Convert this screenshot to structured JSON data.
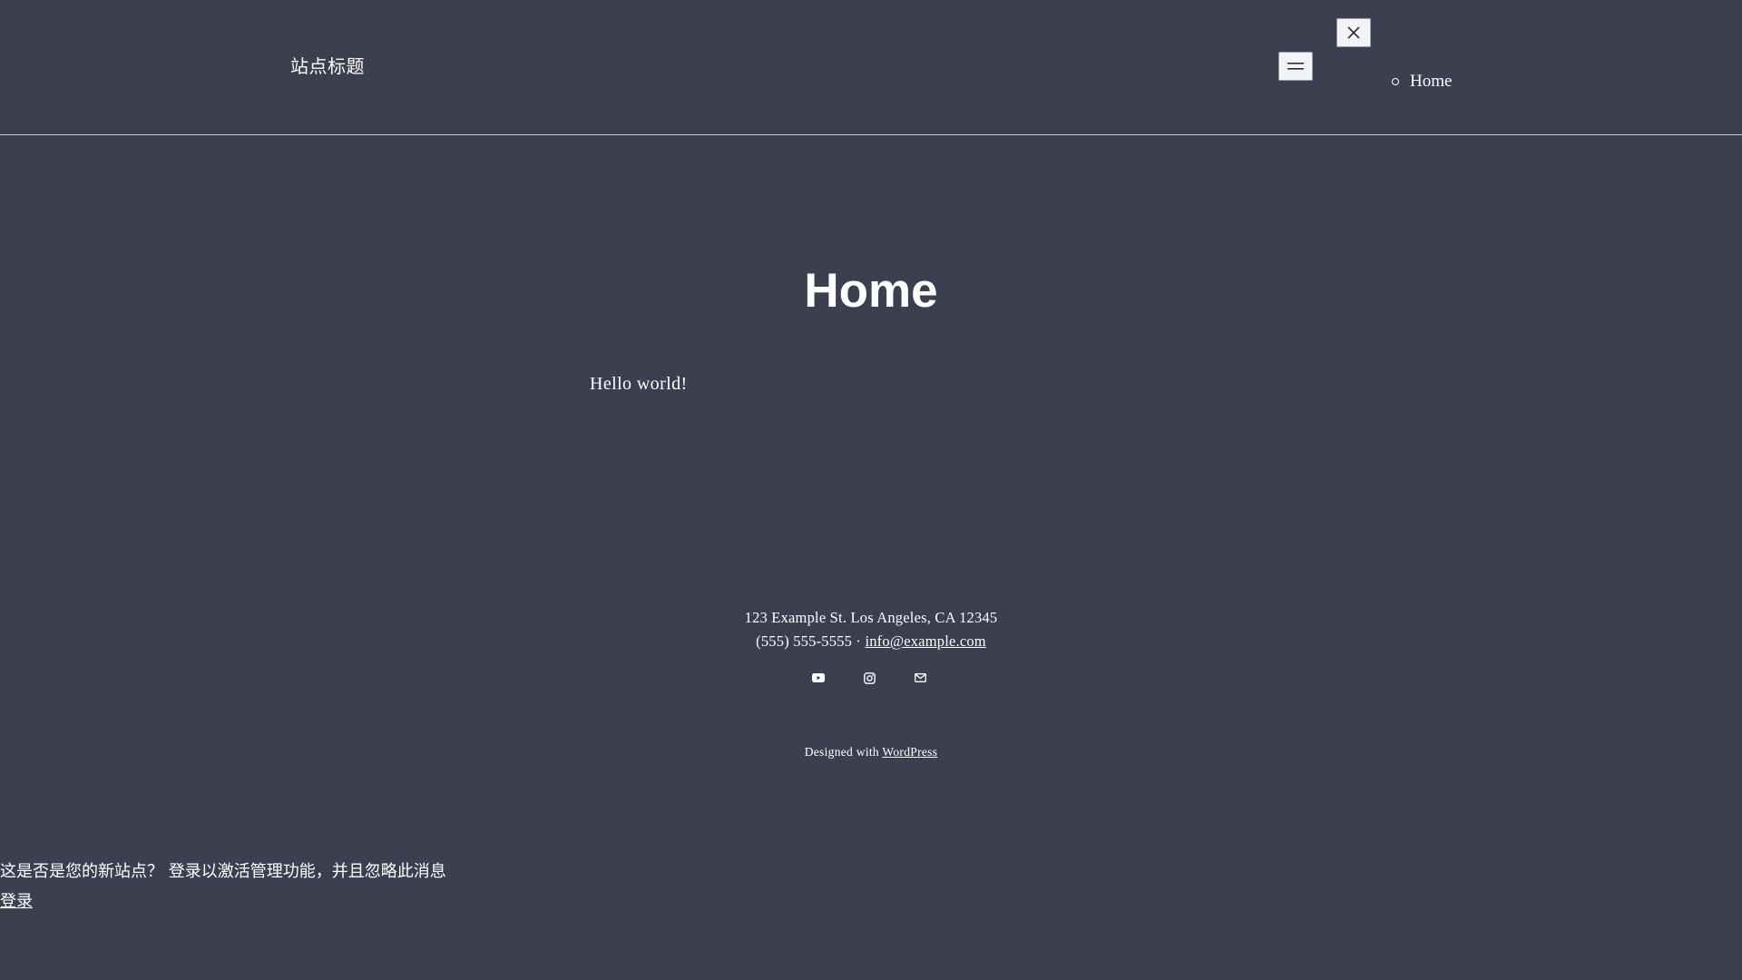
{
  "header": {
    "site_title": "站点标题",
    "nav": [
      {
        "label": "Home"
      }
    ]
  },
  "main": {
    "page_title": "Home",
    "content": "Hello world!"
  },
  "footer": {
    "address": "123 Example St. Los Angeles, CA 12345",
    "phone": "(555) 555-5555",
    "separator": "·",
    "email": "info@example.com",
    "socials": [
      {
        "icon": "youtube-icon"
      },
      {
        "icon": "instagram-icon"
      },
      {
        "icon": "mail-icon"
      }
    ],
    "credit_prefix": "Designed with",
    "credit_link": "WordPress"
  },
  "notice": {
    "message": "这是否是您的新站点？ 登录以激活管理功能，并且忽略此消息",
    "login_link": "登录"
  }
}
